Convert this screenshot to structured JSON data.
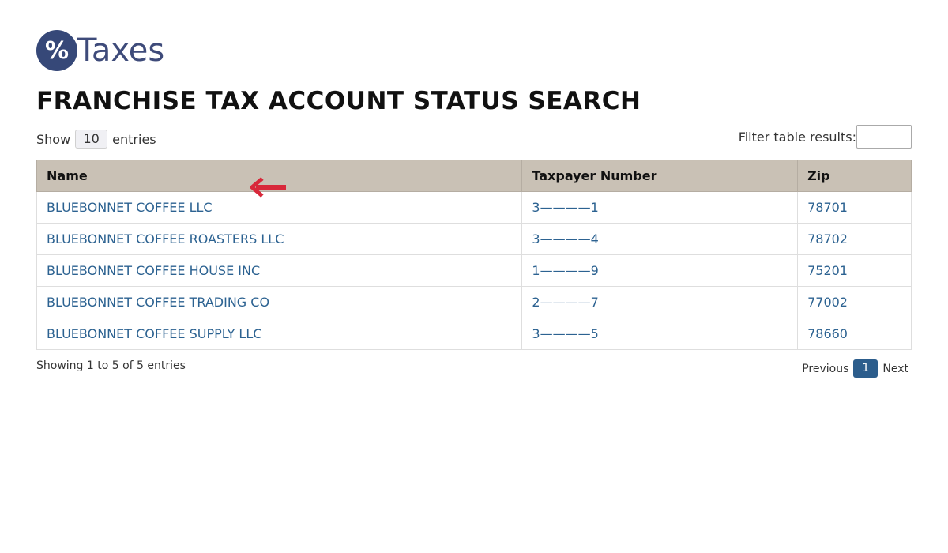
{
  "logo": {
    "symbol": "%",
    "text": "Taxes",
    "colors": {
      "badge": "#364878",
      "text": "#3e4b7a"
    }
  },
  "page_title": "FRANCHISE TAX ACCOUNT STATUS SEARCH",
  "length_control": {
    "prefix": "Show",
    "value": "10",
    "suffix": "entries"
  },
  "filter": {
    "label": "Filter table results:",
    "value": ""
  },
  "table": {
    "headers": [
      "Name",
      "Taxpayer Number",
      "Zip"
    ],
    "header_color": "#c9c1b5",
    "link_color": "#2c6291",
    "rows": [
      {
        "name": "BLUEBONNET COFFEE LLC",
        "taxpayer": "3————1",
        "zip": "78701"
      },
      {
        "name": "BLUEBONNET COFFEE ROASTERS LLC",
        "taxpayer": "3————4",
        "zip": "78702"
      },
      {
        "name": "BLUEBONNET COFFEE HOUSE INC",
        "taxpayer": "1————9",
        "zip": "75201"
      },
      {
        "name": "BLUEBONNET COFFEE TRADING CO",
        "taxpayer": "2————7",
        "zip": "77002"
      },
      {
        "name": "BLUEBONNET COFFEE SUPPLY LLC",
        "taxpayer": "3————5",
        "zip": "78660"
      }
    ]
  },
  "annotation": {
    "icon": "left-arrow-icon",
    "color": "#d8283a"
  },
  "info_text": "Showing 1 to 5 of 5 entries",
  "pagination": {
    "previous": "Previous",
    "current": "1",
    "next": "Next",
    "current_color": "#2c5d8c"
  }
}
